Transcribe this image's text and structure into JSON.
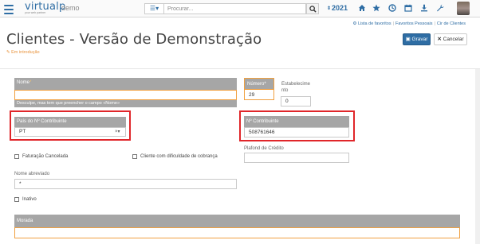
{
  "app": {
    "logo": "virtualp",
    "logo_tagline": "your web partner",
    "environment": "demo"
  },
  "topbar": {
    "search_placeholder": "Procurar...",
    "year": "2021"
  },
  "links": {
    "favorites": "Lista de favoritos",
    "personal_favorites": "Favoritos Pessoais",
    "cir": "Cir de Clientes"
  },
  "page": {
    "title": "Clientes - Versão de Demonstração",
    "status": "Em introdução",
    "save_label": "Gravar",
    "cancel_label": "Cancelar"
  },
  "form": {
    "name_label": "Nome",
    "name_required_mark": "*",
    "name_value": "",
    "name_error": "Desculpe, mas tem que preencher o campo «Nome»",
    "number_label": "Número",
    "number_required_mark": "*",
    "number_value": "29",
    "establishment_label_1": "Estabelecime",
    "establishment_label_2": "nto",
    "establishment_value": "0",
    "country_label": "País do Nº Contribuinte",
    "country_value": "PT",
    "country_clear": "×",
    "nif_label": "Nº Contribuinte",
    "nif_value": "508761646",
    "credit_label": "Plafond de Crédito",
    "credit_value": "",
    "billing_cancelled_label": "Faturação Cancelada",
    "collection_difficulty_label": "Cliente com dificuldade de cobrança",
    "short_name_label": "Nome abreviado",
    "short_name_value": "*",
    "inactive_label": "Inativo",
    "address_label": "Morada",
    "address_value": ""
  }
}
